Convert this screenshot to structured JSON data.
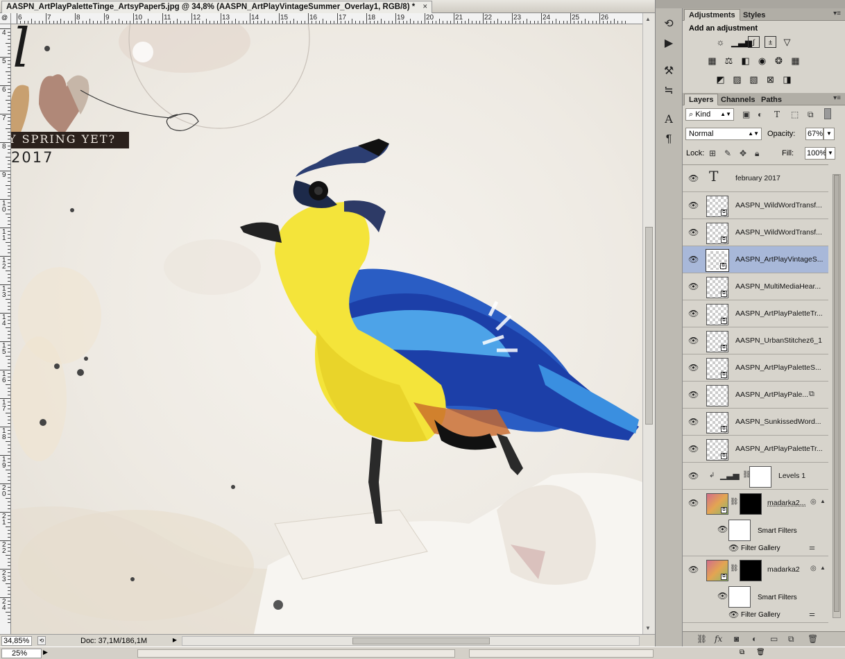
{
  "document": {
    "tab_title": "AASPN_ArtPlayPaletteTinge_ArtsyPaper5.jpg @ 34,8% (AASPN_ArtPlayVintageSummer_Overlay1, RGB/8) *",
    "close_glyph": "×",
    "zoom": "34,85%",
    "doc_size": "Doc: 37,1M/186,1M",
    "ruler_h": [
      "6",
      "7",
      "8",
      "9",
      "10",
      "11",
      "12",
      "13",
      "14",
      "15",
      "16",
      "17",
      "18",
      "19",
      "20",
      "21",
      "22",
      "23",
      "24",
      "25",
      "26"
    ],
    "ruler_v": [
      "4",
      "5",
      "6",
      "7",
      "8",
      "9",
      "10",
      "11",
      "12",
      "13",
      "14",
      "15",
      "16",
      "17",
      "18",
      "19",
      "20",
      "21",
      "22",
      "23",
      "24"
    ],
    "ruler_corner": "@"
  },
  "artwork": {
    "spring_text": "Y SPRING YET?",
    "year_text": "2017",
    "script_letter": "l"
  },
  "appbar": {
    "zoom": "25%"
  },
  "adjustments": {
    "tabs": [
      "Adjustments",
      "Styles"
    ],
    "title": "Add an adjustment",
    "icons_row1": [
      "brightness-icon",
      "levels-icon",
      "curves-icon",
      "exposure-icon",
      "vibrance-icon"
    ],
    "icons_row2": [
      "hue-saturation-icon",
      "color-balance-icon",
      "black-white-icon",
      "photo-filter-icon",
      "channel-mixer-icon",
      "color-lookup-icon"
    ],
    "icons_row3": [
      "invert-icon",
      "posterize-icon",
      "threshold-icon",
      "selective-color-icon",
      "gradient-map-icon"
    ]
  },
  "layers_panel": {
    "tabs": [
      "Layers",
      "Channels",
      "Paths"
    ],
    "filter_kind": "Kind",
    "blend_mode": "Normal",
    "opacity_label": "Opacity:",
    "opacity_value": "67%",
    "lock_label": "Lock:",
    "fill_label": "Fill:",
    "fill_value": "100%",
    "layers": [
      {
        "name": "february 2017",
        "type": "text"
      },
      {
        "name": "AASPN_WildWordTransf...",
        "type": "smart"
      },
      {
        "name": "AASPN_WildWordTransf...",
        "type": "smart"
      },
      {
        "name": "AASPN_ArtPlayVintageS...",
        "type": "smart",
        "selected": true
      },
      {
        "name": "AASPN_MultiMediaHear...",
        "type": "smart"
      },
      {
        "name": "AASPN_ArtPlayPaletteTr...",
        "type": "smart"
      },
      {
        "name": "AASPN_UrbanStitchez6_1",
        "type": "smart"
      },
      {
        "name": "AASPN_ArtPlayPaletteS...",
        "type": "smart"
      },
      {
        "name": "AASPN_ArtPlayPale...",
        "type": "smart"
      },
      {
        "name": "AASPN_SunkissedWord...",
        "type": "smart"
      },
      {
        "name": "AASPN_ArtPlayPaletteTr...",
        "type": "smart"
      },
      {
        "name": "Levels 1",
        "type": "adjustment"
      },
      {
        "name": "madarka2...",
        "type": "photo"
      },
      {
        "name": "madarka2",
        "type": "photo"
      }
    ],
    "smart_filters_label": "Smart Filters",
    "filter_gallery_label": "Filter Gallery"
  },
  "colors": {
    "selected_layer": "#a8b8d9",
    "panel_bg": "#d7d4cc"
  }
}
